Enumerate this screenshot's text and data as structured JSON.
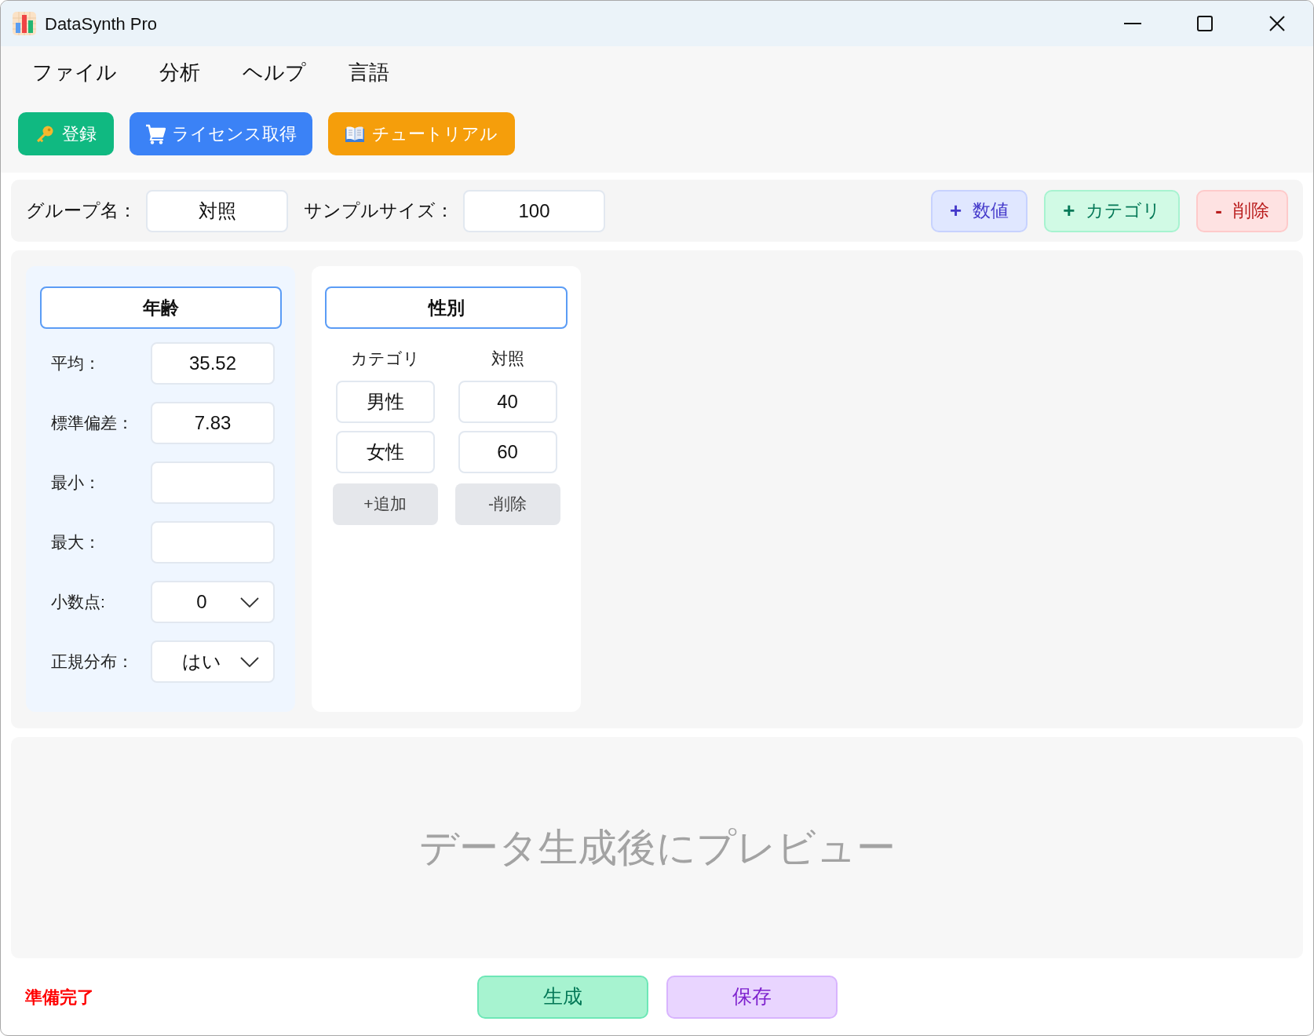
{
  "window": {
    "title": "DataSynth Pro"
  },
  "menu": [
    {
      "label": "ファイル"
    },
    {
      "label": "分析"
    },
    {
      "label": "ヘルプ"
    },
    {
      "label": "言語"
    }
  ],
  "toolbar": [
    {
      "kind": "register",
      "label": "登録"
    },
    {
      "kind": "license",
      "label": "ライセンス取得"
    },
    {
      "kind": "tutorial",
      "label": "チュートリアル"
    }
  ],
  "group_bar": {
    "fields": [
      {
        "label": "グループ名：",
        "value": "対照"
      },
      {
        "label": "サンプルサイズ：",
        "value": "100"
      }
    ],
    "buttons": [
      {
        "kind": "add_numeric",
        "sign": "+",
        "label": "数値"
      },
      {
        "kind": "add_category",
        "sign": "+",
        "label": "カテゴリ"
      },
      {
        "kind": "delete",
        "sign": "-",
        "label": "削除"
      }
    ]
  },
  "variables": [
    {
      "kind": "numeric",
      "name": "年齢",
      "params": [
        {
          "kind": "input",
          "label": "平均：",
          "value": "35.52"
        },
        {
          "kind": "input",
          "label": "標準偏差：",
          "value": "7.83"
        },
        {
          "kind": "input",
          "label": "最小："
        },
        {
          "kind": "input",
          "label": "最大："
        },
        {
          "kind": "select",
          "label": "小数点:",
          "value": "0"
        },
        {
          "kind": "select",
          "label": "正規分布：",
          "value": "はい"
        }
      ]
    },
    {
      "kind": "categorical",
      "name": "性別",
      "columns": [
        "カテゴリ",
        "対照"
      ],
      "rows": [
        [
          "男性",
          "40"
        ],
        [
          "女性",
          "60"
        ]
      ],
      "buttons": [
        "+追加",
        "-削除"
      ]
    }
  ],
  "preview": {
    "message": "データ生成後にプレビュー"
  },
  "status": {
    "text": "準備完了"
  },
  "actions": [
    {
      "kind": "generate",
      "label": "生成"
    },
    {
      "kind": "save",
      "label": "保存"
    }
  ]
}
